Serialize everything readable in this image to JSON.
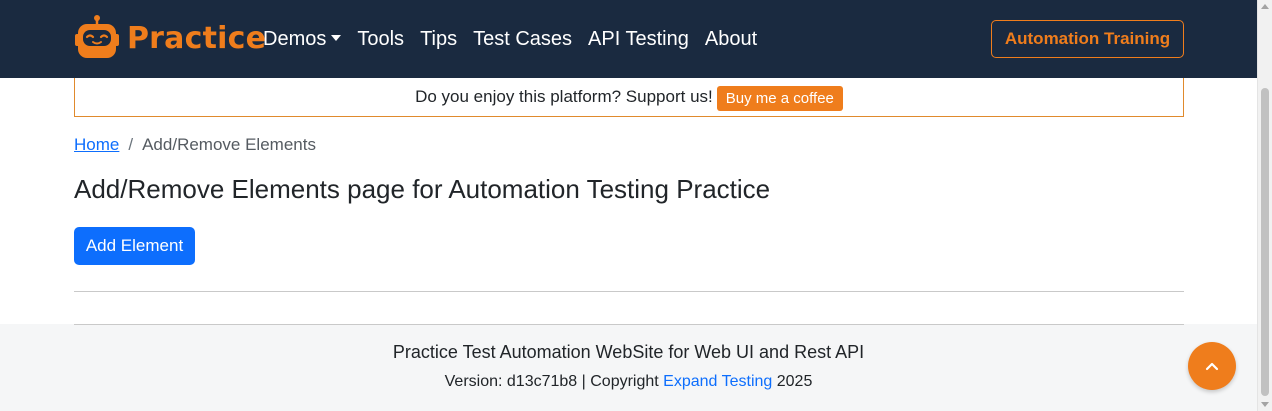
{
  "navbar": {
    "brand": "Practice",
    "links": [
      "Demos",
      "Tools",
      "Tips",
      "Test Cases",
      "API Testing",
      "About"
    ],
    "training_button": "Automation Training"
  },
  "support": {
    "text": "Do you enjoy this platform? Support us!",
    "button": "Buy me a coffee"
  },
  "breadcrumb": {
    "home": "Home",
    "separator": "/",
    "current": "Add/Remove Elements"
  },
  "main": {
    "title": "Add/Remove Elements page for Automation Testing Practice",
    "add_button": "Add Element"
  },
  "footer": {
    "line1": "Practice Test Automation WebSite for Web UI and Rest API",
    "version_prefix": "Version: d13c71b8 | Copyright",
    "link": "Expand Testing",
    "year": "2025"
  },
  "colors": {
    "navbar_bg": "#1a2a40",
    "accent_orange": "#ef7d1c",
    "primary_blue": "#0d6efd",
    "footer_bg": "#f5f6f7"
  },
  "icons": {
    "logo": "robot-logo-icon",
    "dropdown": "caret-down-icon",
    "back_to_top": "chevron-up-icon"
  }
}
